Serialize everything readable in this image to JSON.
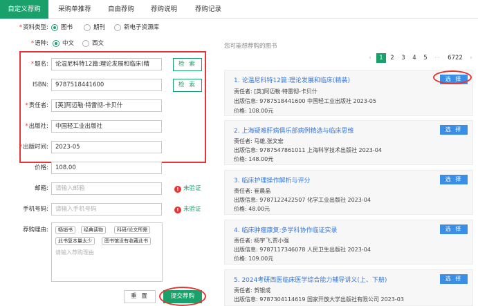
{
  "tabs": [
    "自定义荐购",
    "采购单推荐",
    "自由荐购",
    "荐购说明",
    "荐购记录"
  ],
  "form": {
    "resource_type": {
      "label": "资料类型:",
      "options": [
        "图书",
        "期刊",
        "新电子资源库"
      ],
      "selected": 0
    },
    "language": {
      "label": "语种:",
      "options": [
        "中文",
        "西文"
      ],
      "selected": 0
    },
    "title": {
      "label": "题名:",
      "value": "论温尼科特12篇:理论发展和临床(精",
      "btn": "检 索"
    },
    "isbn": {
      "label": "ISBN:",
      "value": "9787518441600",
      "btn": "检 索"
    },
    "author": {
      "label": "责任者:",
      "value": "[英]阿迈勒·特雷彻-卡贝什"
    },
    "publisher": {
      "label": "出版社:",
      "value": "中国轻工业出版社"
    },
    "pub_date": {
      "label": "出版时间:",
      "value": "2023-05"
    },
    "price": {
      "label": "价格:",
      "value": "108.00"
    },
    "email": {
      "label": "邮箱:",
      "placeholder": "请输入邮箱",
      "status": "未验证"
    },
    "phone": {
      "label": "手机号码:",
      "placeholder": "请输入手机号码",
      "status": "未验证"
    },
    "reason": {
      "label": "荐购理由:",
      "tags": [
        "畅销书",
        "经典读物",
        "科研/论文所需",
        "此书复本量太少",
        "图书馆没有收藏此书"
      ],
      "placeholder": "请输入荐购理由"
    },
    "reset_btn": "重 置",
    "submit_btn": "提交荐购"
  },
  "recommend": {
    "heading": "您可能想荐购的图书",
    "pager": {
      "prev": "‹",
      "pages": [
        "1",
        "2",
        "3",
        "4",
        "5"
      ],
      "ellipsis": "···",
      "last": "6722",
      "next": "›",
      "current": "1"
    },
    "books": [
      {
        "title": "1. 论温尼科特12篇:理论发展和临床(精装)",
        "author": "责任者: [英]阿迈勒·特雷彻-卡贝什",
        "pub": "出版信息: 9787518441600  中国轻工业出版社  2023-05",
        "price": "价格: 108.00元",
        "btn": "选 择"
      },
      {
        "title": "2. 上海疑难肝病俱乐部病例精选与临床思维",
        "author": "责任者: 马雄,张文宏",
        "pub": "出版信息: 9787547861011  上海科学技术出版社  2023-04",
        "price": "价格: 148.00元",
        "btn": "选 择"
      },
      {
        "title": "3. 临床护理操作解析与评分",
        "author": "责任者: 崔晨晶",
        "pub": "出版信息: 9787122422507  化学工业出版社  2023-04",
        "price": "价格: 48.00元",
        "btn": "选 择"
      },
      {
        "title": "4. 临床肿瘤康复:多学科协作临证实录",
        "author": "责任者: 杨宇飞,贾小强",
        "pub": "出版信息: 9787117346078  人民卫生出版社  2023-04",
        "price": "价格: 109.00元",
        "btn": "选 择"
      },
      {
        "title": "5. 2024考研西医临床医学综合能力辅导讲义(上、下册)",
        "author": "责任者: 贺银成",
        "pub": "出版信息: 9787304114619  国家开放大学出版社有限公司  2023-03",
        "btn": "选 择"
      }
    ]
  }
}
